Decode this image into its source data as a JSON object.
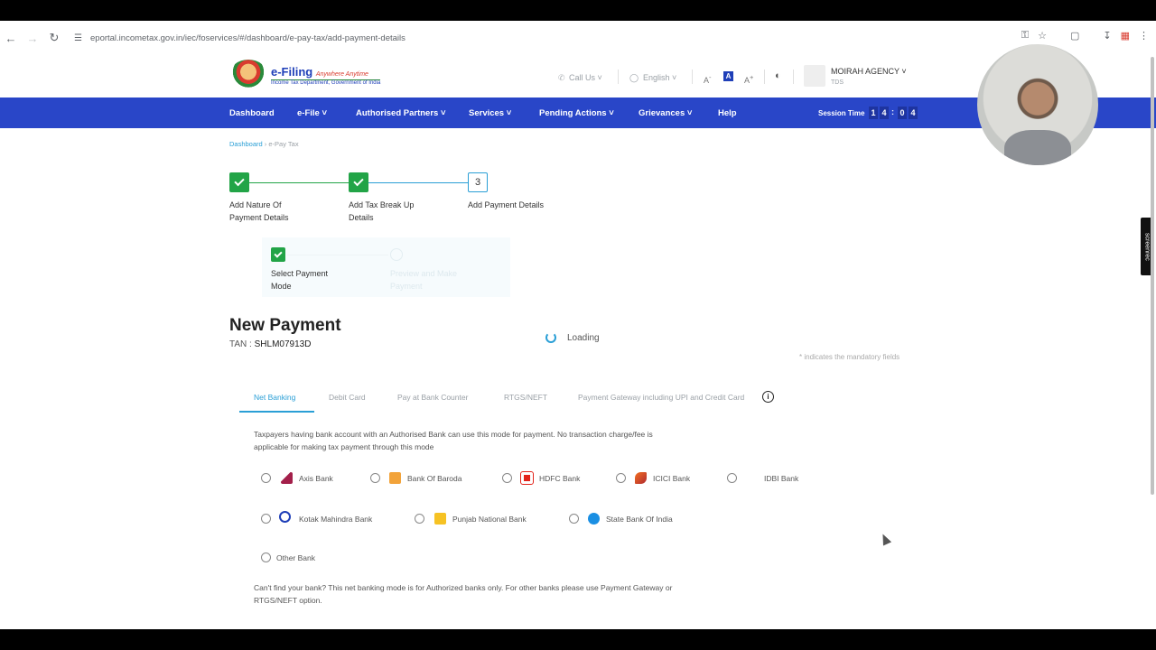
{
  "browser": {
    "url": "eportal.incometax.gov.in/iec/foservices/#/dashboard/e-pay-tax/add-payment-details"
  },
  "header": {
    "logo_title": "e-Filing",
    "logo_tagline": "Anywhere Anytime",
    "logo_sub": "Income Tax Department, Government of India",
    "call_us": "Call Us",
    "language": "English",
    "font_decrease": "A",
    "font_normal": "A",
    "font_increase": "A",
    "user_name": "MOIRAH AGENCY",
    "user_role": "TDS"
  },
  "nav": {
    "items": [
      "Dashboard",
      "e-File",
      "Authorised Partners",
      "Services",
      "Pending Actions",
      "Grievances",
      "Help"
    ],
    "session_label": "Session Time",
    "session_digits": [
      "1",
      "4",
      "0",
      "4"
    ]
  },
  "breadcrumb": {
    "home": "Dashboard",
    "current": "e-Pay Tax"
  },
  "stepper": {
    "steps": [
      {
        "label": "Add Nature Of Payment Details"
      },
      {
        "label": "Add Tax Break Up Details"
      },
      {
        "number": "3",
        "label": "Add Payment Details"
      }
    ],
    "substeps": [
      {
        "label": "Select Payment Mode"
      },
      {
        "label": "Preview and Make Payment"
      }
    ]
  },
  "main": {
    "title": "New Payment",
    "tan_label": "TAN :",
    "tan_value": "SHLM07913D",
    "loading": "Loading",
    "mandatory_note": "* indicates the mandatory fields",
    "tabs": [
      "Net Banking",
      "Debit Card",
      "Pay at Bank Counter",
      "RTGS/NEFT",
      "Payment Gateway including UPI and Credit Card"
    ],
    "description": "Taxpayers having bank account with an Authorised Bank can use this mode for payment. No transaction charge/fee is applicable for making tax payment through this mode",
    "banks_row1": [
      "Axis Bank",
      "Bank Of Baroda",
      "HDFC Bank",
      "ICICI Bank",
      "IDBI Bank"
    ],
    "banks_row2": [
      "Kotak Mahindra Bank",
      "Punjab National Bank",
      "State Bank Of India"
    ],
    "other_bank": "Other Bank",
    "footer_note": "Can't find your bank? This net banking mode is for Authorized banks only. For other banks please use Payment Gateway or RTGS/NEFT option."
  },
  "overlay": {
    "screenrec": "screenrec"
  },
  "colors": {
    "nav_blue": "#2946c8",
    "success_green": "#22a447",
    "link_blue": "#2a9fd6"
  }
}
